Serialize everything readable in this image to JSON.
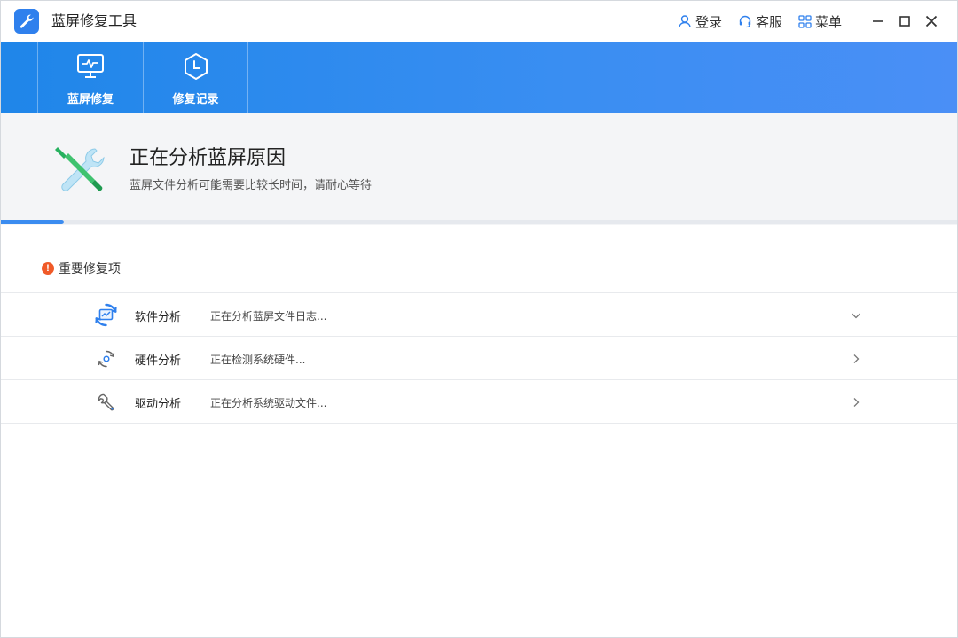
{
  "app": {
    "title": "蓝屏修复工具",
    "accent_color": "#2f80ed"
  },
  "titlebar": {
    "login_label": "登录",
    "service_label": "客服",
    "menu_label": "菜单",
    "icons": [
      "user-icon",
      "headset-icon",
      "grid-icon",
      "minimize-icon",
      "maximize-icon",
      "close-icon"
    ]
  },
  "nav": {
    "items": [
      {
        "label": "蓝屏修复",
        "icon": "monitor-pulse-icon"
      },
      {
        "label": "修复记录",
        "icon": "clock-hex-icon"
      }
    ]
  },
  "status": {
    "title": "正在分析蓝屏原因",
    "subtitle": "蓝屏文件分析可能需要比较长时间，请耐心等待",
    "icon": "tools-icon",
    "progress_fraction": 0.066
  },
  "section": {
    "title": "重要修复项",
    "badge": "!"
  },
  "rows": [
    {
      "name": "软件分析",
      "status": "正在分析蓝屏文件日志...",
      "icon": "software-analysis-icon",
      "expanded": true
    },
    {
      "name": "硬件分析",
      "status": "正在检测系统硬件...",
      "icon": "hardware-analysis-icon",
      "expanded": false
    },
    {
      "name": "驱动分析",
      "status": "正在分析系统驱动文件...",
      "icon": "driver-analysis-icon",
      "expanded": false
    }
  ]
}
